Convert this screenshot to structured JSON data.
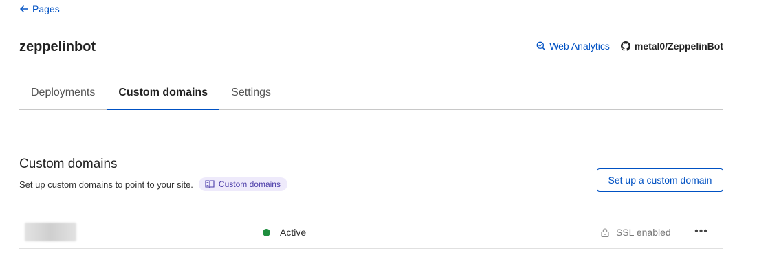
{
  "nav": {
    "back_label": "Pages"
  },
  "project": {
    "name": "zeppelinbot"
  },
  "header_links": {
    "analytics_label": "Web Analytics",
    "repo_label": "metal0/ZeppelinBot"
  },
  "tabs": [
    {
      "label": "Deployments",
      "active": false
    },
    {
      "label": "Custom domains",
      "active": true
    },
    {
      "label": "Settings",
      "active": false
    }
  ],
  "section": {
    "title": "Custom domains",
    "description": "Set up custom domains to point to your site.",
    "docs_label": "Custom domains",
    "setup_button_label": "Set up a custom domain"
  },
  "domains": [
    {
      "domain": "",
      "status": "Active",
      "ssl": "SSL enabled",
      "more_label": "•••"
    }
  ],
  "colors": {
    "accent": "#0051c3",
    "active_status": "#1e8e3e",
    "docs_pill_bg": "#eeeafb"
  },
  "icons": {
    "back": "arrow-left-icon",
    "analytics": "zoom-analytics-icon",
    "repo": "github-icon",
    "docs": "book-icon",
    "ssl": "lock-icon",
    "more": "ellipsis-icon"
  }
}
